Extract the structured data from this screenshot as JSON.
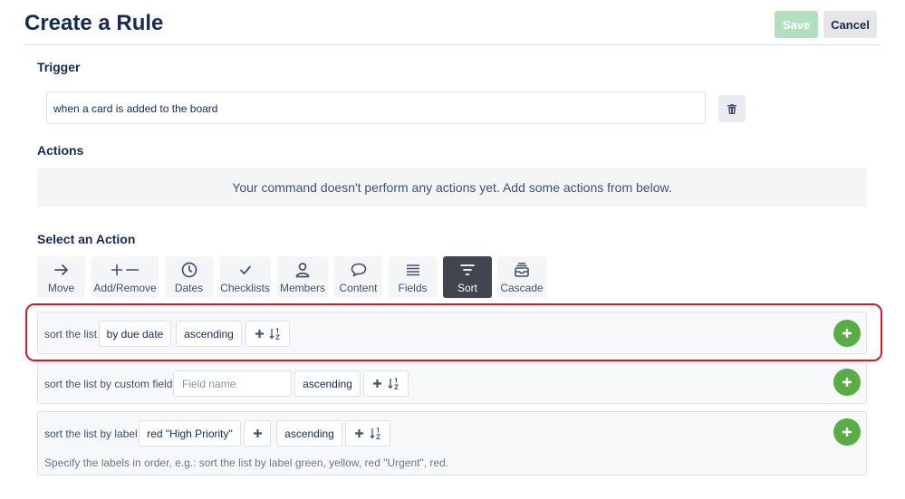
{
  "header": {
    "title": "Create a Rule",
    "save_label": "Save",
    "cancel_label": "Cancel"
  },
  "trigger": {
    "label": "Trigger",
    "value": "when a card is added to the board"
  },
  "actions": {
    "label": "Actions",
    "empty_message": "Your command doesn't perform any actions yet. Add some actions from below."
  },
  "select_action": {
    "label": "Select an Action",
    "tabs": [
      {
        "label": "Move",
        "icon": "arrow-right-icon"
      },
      {
        "label": "Add/Remove",
        "icon": "plus-minus-icon"
      },
      {
        "label": "Dates",
        "icon": "clock-icon"
      },
      {
        "label": "Checklists",
        "icon": "checkmark-icon"
      },
      {
        "label": "Members",
        "icon": "person-icon"
      },
      {
        "label": "Content",
        "icon": "speech-bubble-icon"
      },
      {
        "label": "Fields",
        "icon": "lines-icon"
      },
      {
        "label": "Sort",
        "icon": "filter-icon",
        "active": true
      },
      {
        "label": "Cascade",
        "icon": "inbox-icon"
      }
    ]
  },
  "sort_cards": [
    {
      "prefix": "sort the list",
      "field": "by due date",
      "order": "ascending"
    },
    {
      "prefix": "sort the list by custom field",
      "field_placeholder": "Field name",
      "order": "ascending"
    },
    {
      "prefix": "sort the list by label",
      "label_value": "red \"High Priority\"",
      "order": "ascending",
      "hint": "Specify the labels in order, e.g.: sort the list by label green, yellow, red \"Urgent\", red."
    }
  ],
  "colors": {
    "accent_green": "#5aac44",
    "highlight_red": "#cc1e2a",
    "active_tab": "#42444f"
  }
}
